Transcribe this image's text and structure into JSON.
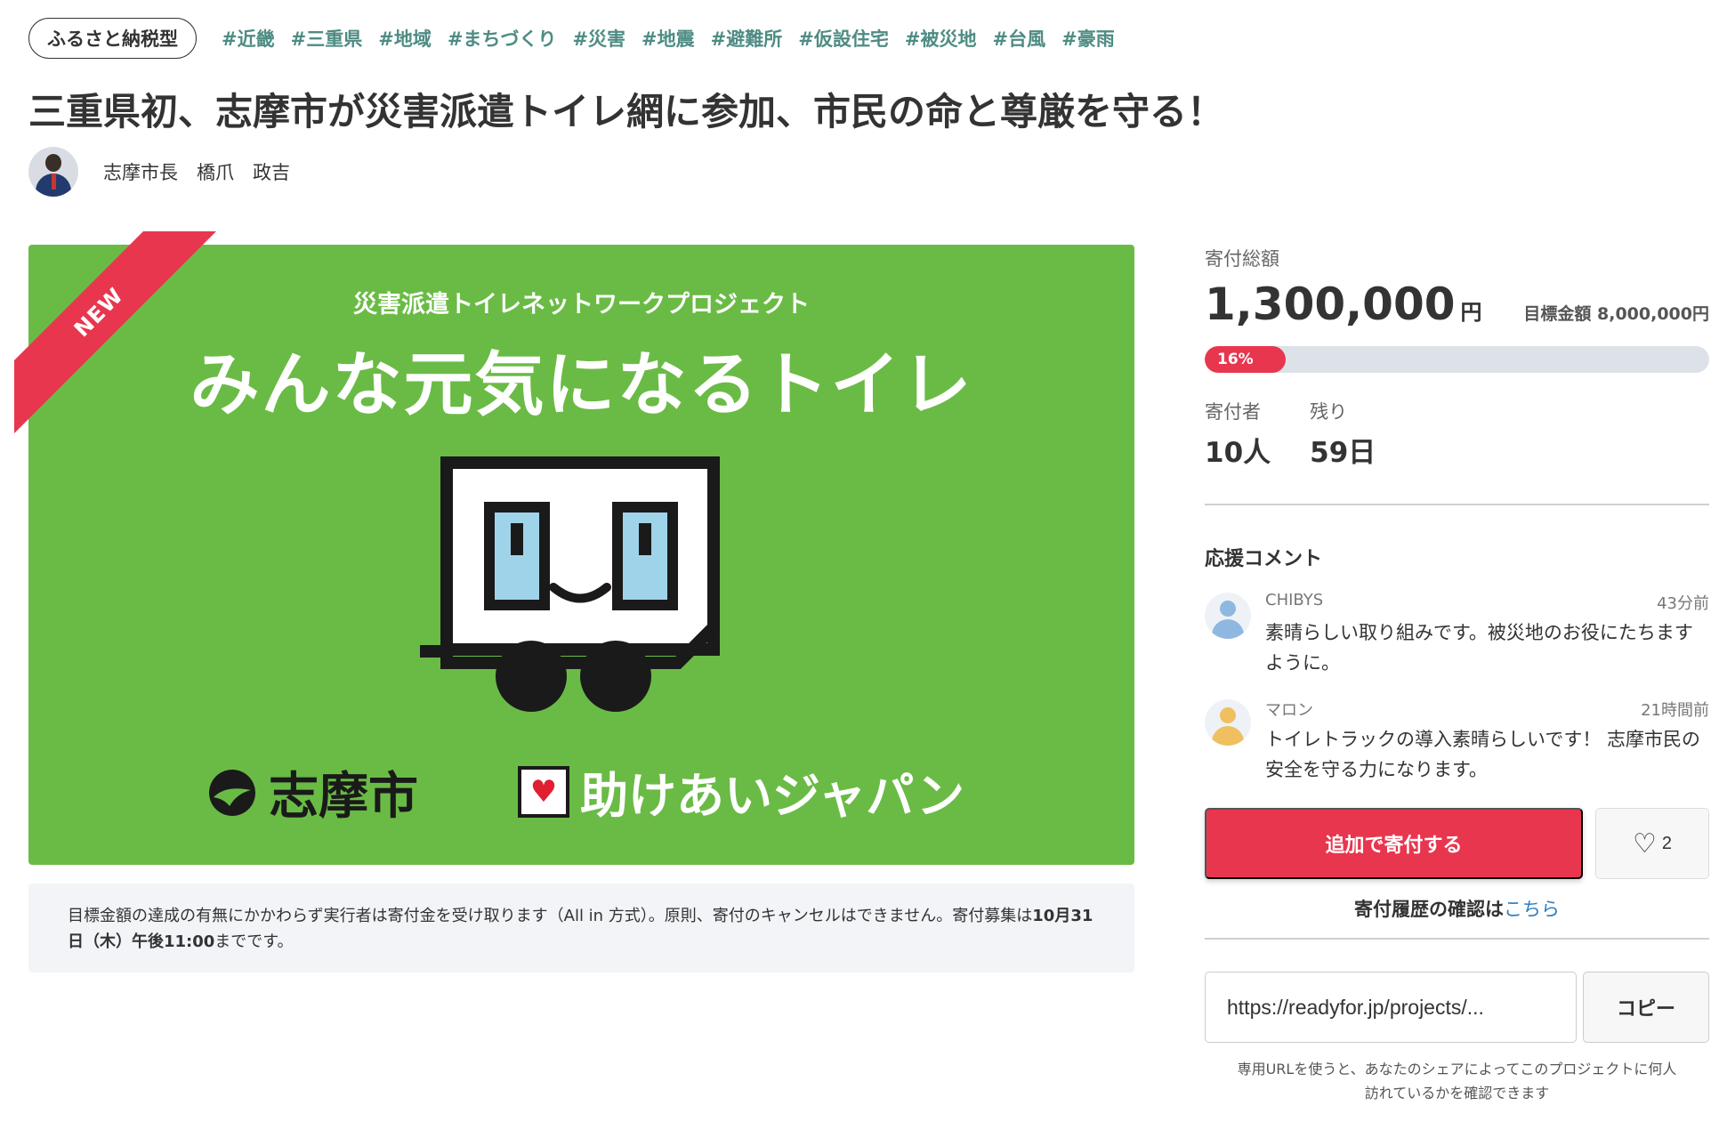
{
  "project_type": "ふるさと納税型",
  "tags": [
    "#近畿",
    "#三重県",
    "#地域",
    "#まちづくり",
    "#災害",
    "#地震",
    "#避難所",
    "#仮設住宅",
    "#被災地",
    "#台風",
    "#豪雨"
  ],
  "title": "三重県初、志摩市が災害派遣トイレ網に参加、市民の命と尊厳を守る！",
  "owner": {
    "name": "志摩市長　橋爪　政吉"
  },
  "hero": {
    "badge": "NEW",
    "subtitle": "災害派遣トイレネットワークプロジェクト",
    "title": "みんな元気になるトイレ",
    "city": "志摩市",
    "partner": "助けあいジャパン",
    "colors": {
      "background": "#6abb45",
      "ribbon": "#e8364f"
    }
  },
  "notice": {
    "part1": "目標金額の達成の有無にかかわらず実行者は寄付金を受け取ります（All in 方式）。原則、寄付のキャンセルはできません。寄付募集は",
    "deadline": "10月31日（木）午後11:00",
    "part2": "までです。"
  },
  "funding": {
    "total_label": "寄付総額",
    "amount": "1,300,000",
    "currency": "円",
    "goal_label": "目標金額",
    "goal_amount": "8,000,000円",
    "progress_text": "16%",
    "progress_fraction": 0.16,
    "supporters_label": "寄付者",
    "supporters_value": "10人",
    "remaining_label": "残り",
    "remaining_value": "59日"
  },
  "comments": {
    "heading": "応援コメント",
    "items": [
      {
        "user": "CHIBYS",
        "time": "43分前",
        "text": "素晴らしい取り組みです。被災地のお役にたちますように。",
        "avatar_color": "#8fb8e0"
      },
      {
        "user": "マロン",
        "time": "21時間前",
        "text": "トイレトラックの導入素晴らしいです！ 志摩市民の安全を守る力になります。",
        "avatar_color": "#f0c060"
      }
    ]
  },
  "actions": {
    "donate_label": "追加で寄付する",
    "favorite_count": "2",
    "history_text": "寄付履歴の確認は",
    "history_link": "こちら",
    "accent_color": "#e8364f",
    "link_color": "#2f7fc1"
  },
  "share": {
    "url": "https://readyfor.jp/projects/...",
    "copy_label": "コピー",
    "note": "専用URLを使うと、あなたのシェアによってこのプロジェクトに何人訪れているかを確認できます"
  }
}
